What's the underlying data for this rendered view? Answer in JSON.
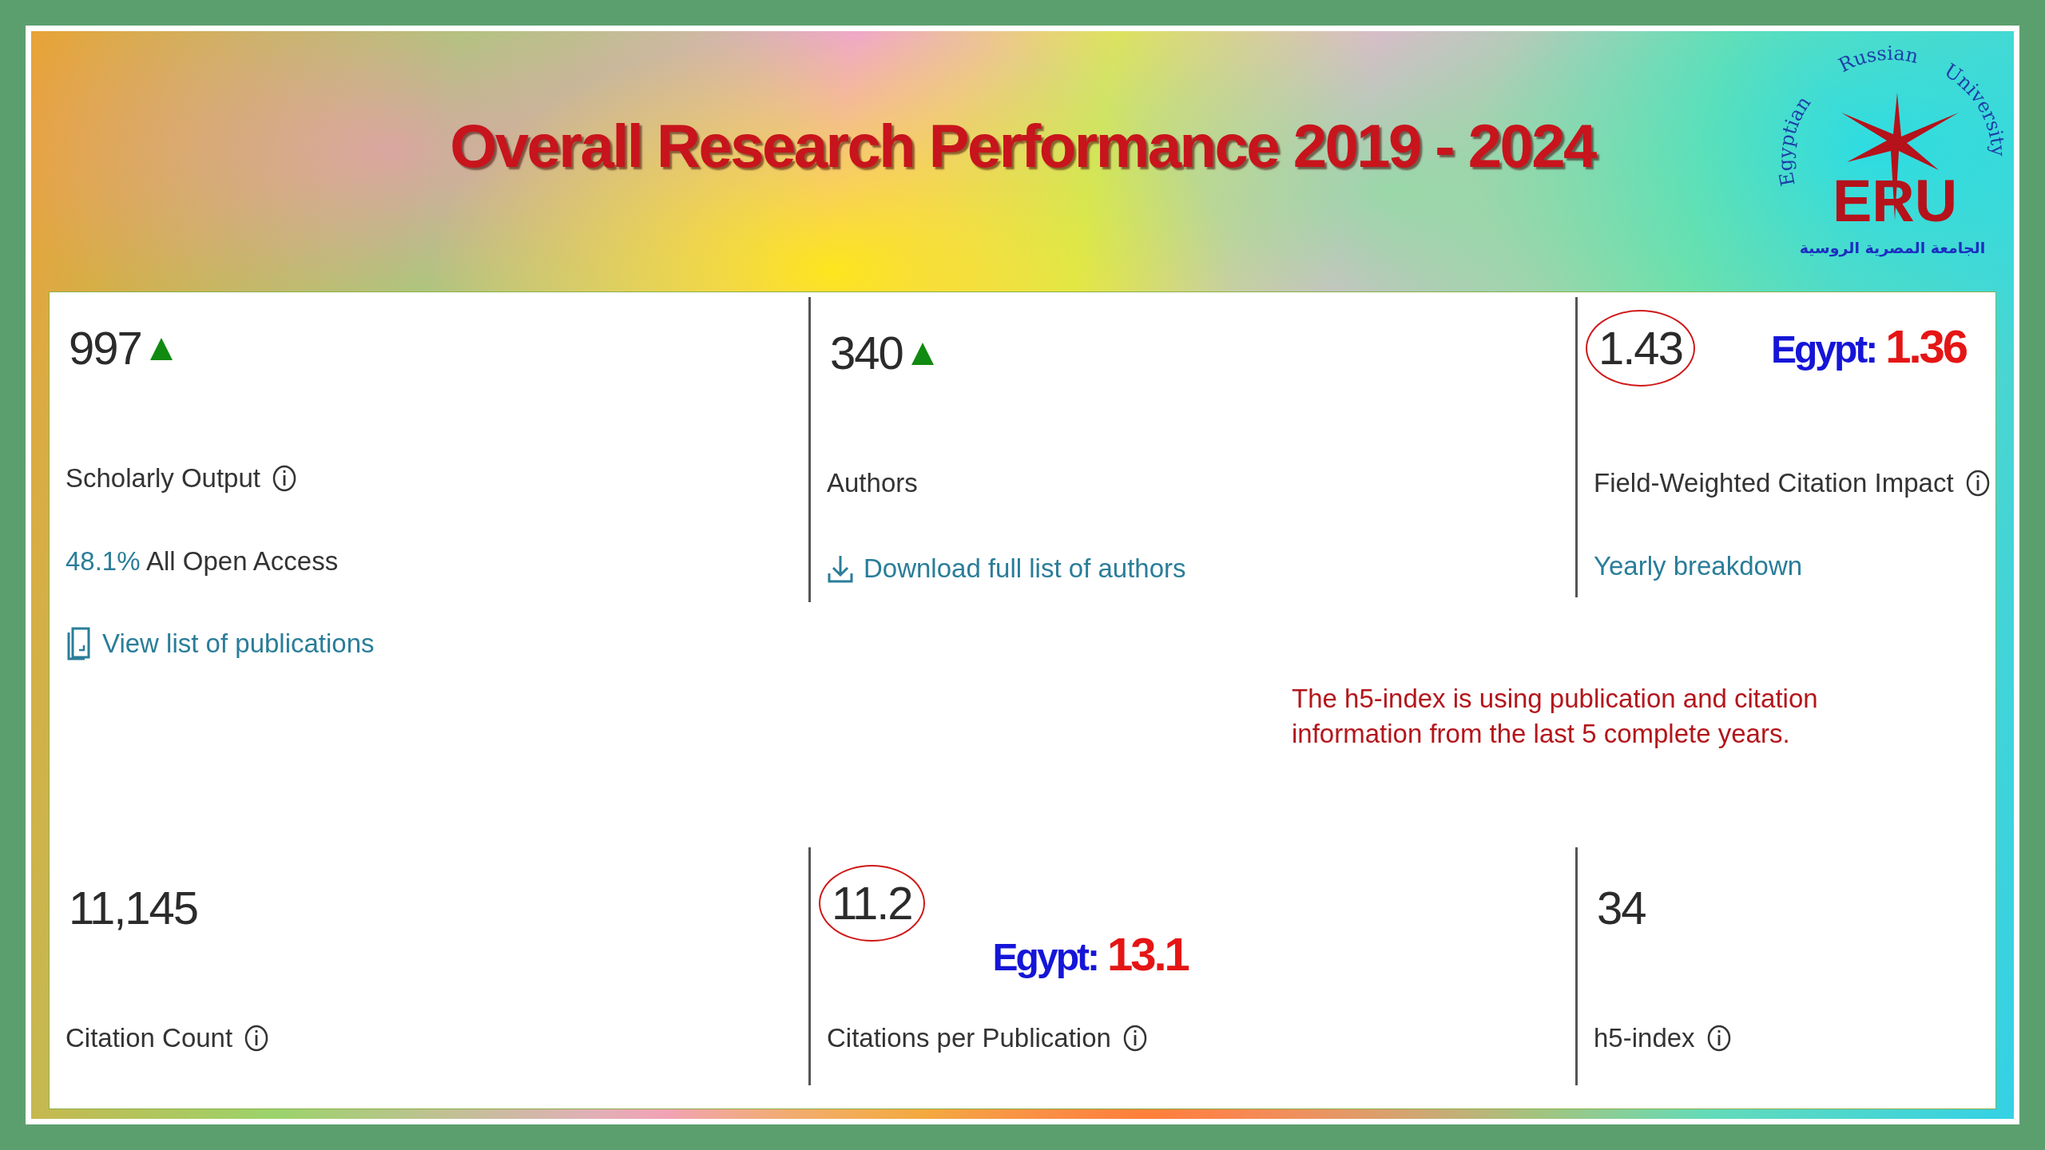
{
  "title": "Overall Research Performance 2019 - 2024",
  "logo": {
    "arc_words": [
      "Egyptian",
      "Russian",
      "University"
    ],
    "initials": "ERU",
    "arabic": "الجامعة المصرية الروسية"
  },
  "top_metrics": [
    {
      "value": "997",
      "trend_up": true,
      "circled": false,
      "label": "Scholarly Output",
      "info": true,
      "lines": [
        {
          "kind": "stat",
          "highlight": "48.1%",
          "text": "All Open Access"
        },
        {
          "kind": "document_link",
          "text": "View list of publications"
        }
      ]
    },
    {
      "value": "340",
      "trend_up": true,
      "circled": false,
      "label": "Authors",
      "info": false,
      "lines": [
        {
          "kind": "download_link",
          "text": "Download full list of authors"
        }
      ]
    },
    {
      "value": "1.43",
      "trend_up": false,
      "circled": true,
      "comparison": {
        "label": "Egypt:",
        "value": "1.36"
      },
      "label": "Field-Weighted Citation Impact",
      "info": true,
      "lines": [
        {
          "kind": "plain_link",
          "text": "Yearly breakdown"
        }
      ]
    }
  ],
  "note": "The h5-index is using publication and citation information from the last 5 complete years.",
  "bottom_metrics": [
    {
      "value": "11,145",
      "trend_up": false,
      "circled": false,
      "label": "Citation Count",
      "info": true
    },
    {
      "value": "11.2",
      "trend_up": false,
      "circled": true,
      "comparison": {
        "label": "Egypt:",
        "value": "13.1"
      },
      "label": "Citations per Publication",
      "info": true
    },
    {
      "value": "34",
      "trend_up": false,
      "circled": false,
      "label": "h5-index",
      "info": true
    }
  ]
}
